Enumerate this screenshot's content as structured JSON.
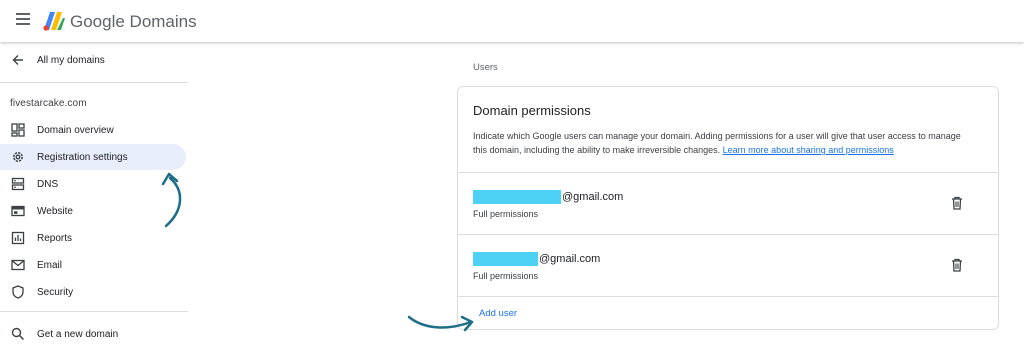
{
  "header": {
    "menu_icon": "hamburger-menu-icon",
    "logo_icon": "google-domains-logo",
    "title": "Google Domains"
  },
  "sidebar": {
    "back_label": "All my domains",
    "domain": "fivestarcake.com",
    "items": [
      {
        "label": "Domain overview",
        "icon": "dashboard-icon"
      },
      {
        "label": "Registration settings",
        "icon": "gear-icon",
        "active": true
      },
      {
        "label": "DNS",
        "icon": "dns-icon"
      },
      {
        "label": "Website",
        "icon": "website-icon"
      },
      {
        "label": "Reports",
        "icon": "reports-icon"
      },
      {
        "label": "Email",
        "icon": "email-icon"
      },
      {
        "label": "Security",
        "icon": "shield-icon"
      }
    ],
    "get_new_domain": "Get a new domain"
  },
  "main": {
    "section_label": "Users",
    "card": {
      "title": "Domain permissions",
      "description": "Indicate which Google users can manage your domain. Adding permissions for a user will give that user access to manage this domain, including the ability to make irreversible changes.",
      "link_text": "Learn more about sharing and permissions",
      "users": [
        {
          "email_suffix": "@gmail.com",
          "permission": "Full permissions"
        },
        {
          "email_suffix": "@gmail.com",
          "permission": "Full permissions"
        }
      ],
      "add_user_label": "Add user"
    }
  },
  "colors": {
    "accent": "#1a73e8",
    "active_nav": "#e8eefc",
    "redaction": "#4dd2f6",
    "annotation_arrow": "#1f6e87"
  }
}
